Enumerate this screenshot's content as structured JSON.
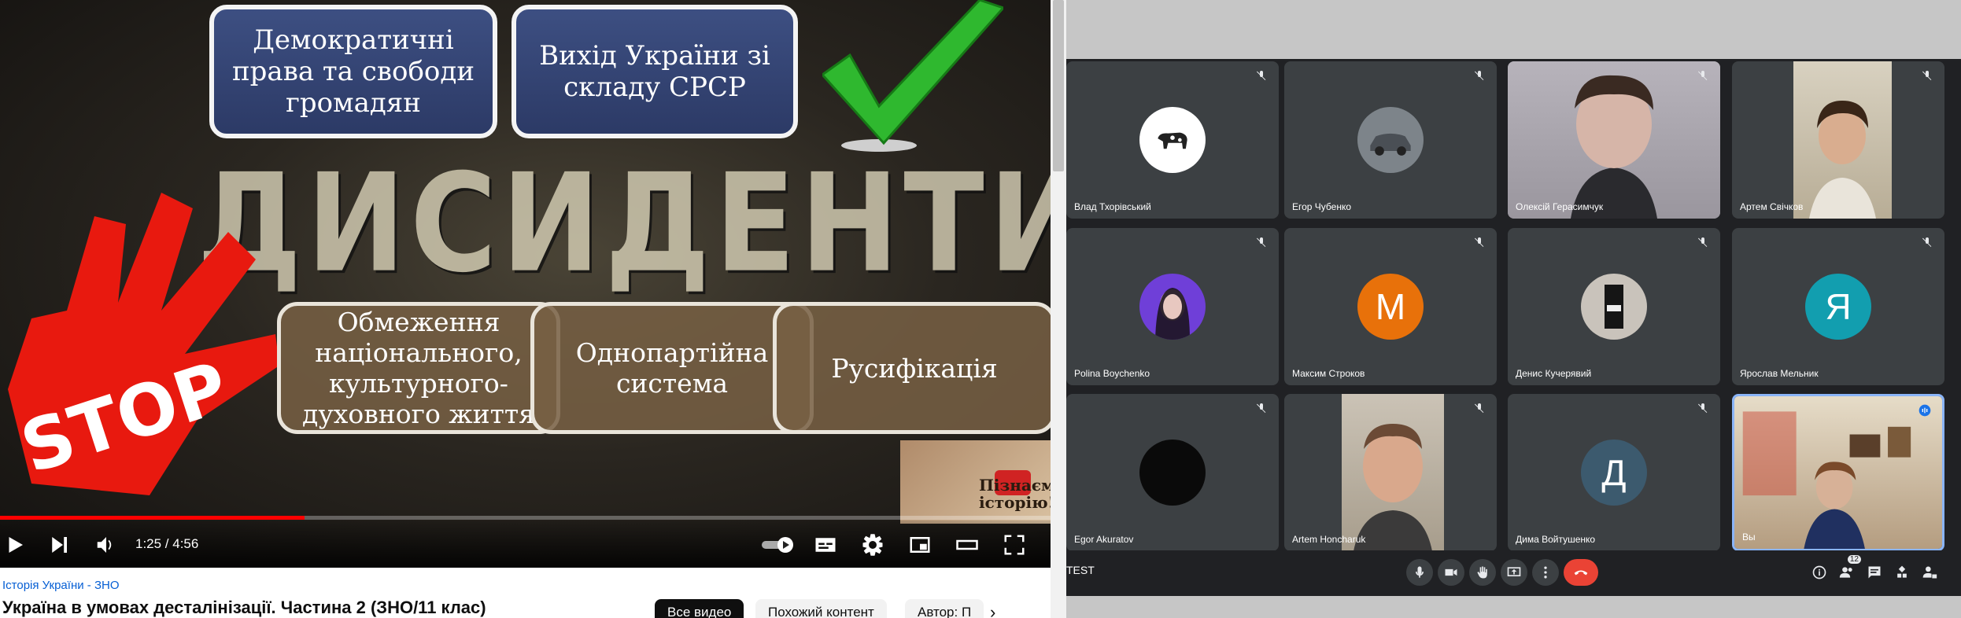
{
  "youtube": {
    "slide": {
      "box_democratic_rights": "Демократичні права та свободи громадян",
      "box_exit_ussr": "Вихід України зі складу СРСР",
      "box_restriction": "Обмеження національного, культурного-духовного життя",
      "box_one_party": "Однопартійна система",
      "box_russification": "Русифікація",
      "banner_word": "ДИСИДЕНТИ",
      "stop_label": "STOP",
      "thumb_text": "Пізнаємо історію!"
    },
    "player": {
      "time": "1:25 / 4:56",
      "progress_played_fraction": 0.29
    },
    "channel_name": "Історія України - ЗНО",
    "video_title": "Україна в умовах десталінізації. Частина 2 (ЗНО/11 клас)",
    "chips": [
      "Все видео",
      "Похожий контент",
      "Автор: П"
    ]
  },
  "meet": {
    "participants": [
      {
        "name": "Влад Тхорівський"
      },
      {
        "name": "Егор Чубенко"
      },
      {
        "name": "Олексій Герасимчук"
      },
      {
        "name": "Артем Свічков"
      },
      {
        "name": "Polina Boychenko"
      },
      {
        "name": "Максим Строков",
        "initial": "М",
        "color": "#e8710a"
      },
      {
        "name": "Денис Кучерявий"
      },
      {
        "name": "Ярослав Мельник",
        "initial": "Я",
        "color": "#129eaf"
      },
      {
        "name": "Egor Akuratov"
      },
      {
        "name": "Artem Honcharuk"
      },
      {
        "name": "Дима Войтушенко",
        "initial": "Д",
        "color": "#3c5a6e"
      },
      {
        "name": "Вы"
      }
    ],
    "meeting_code": "TEST",
    "people_count": "12"
  }
}
